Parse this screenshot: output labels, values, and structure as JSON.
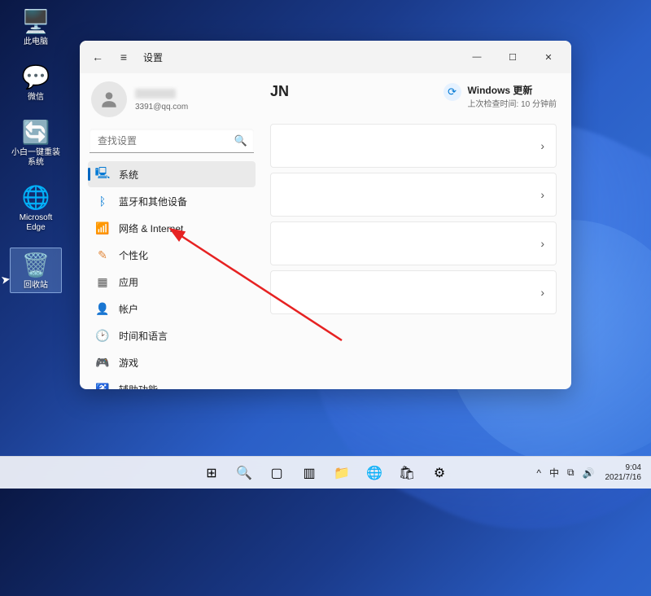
{
  "desktop": {
    "icons": [
      {
        "label": "此电脑",
        "glyph": "🖥️"
      },
      {
        "label": "微信",
        "glyph": "💬"
      },
      {
        "label": "小白一键重装系统",
        "glyph": "🔄"
      },
      {
        "label": "Microsoft Edge",
        "glyph": "🌐"
      },
      {
        "label": "回收站",
        "glyph": "🗑️"
      }
    ]
  },
  "window": {
    "title": "设置",
    "account": {
      "name": "",
      "email": "3391@qq.com"
    },
    "search_placeholder": "查找设置",
    "nav": [
      {
        "label": "系统",
        "icon": "display-icon",
        "glyph": "🖳",
        "color": "c-blue",
        "active": true
      },
      {
        "label": "蓝牙和其他设备",
        "icon": "bluetooth-icon",
        "glyph": "ᛒ",
        "color": "c-blue"
      },
      {
        "label": "网络 & Internet",
        "icon": "wifi-icon",
        "glyph": "📶",
        "color": "c-blue"
      },
      {
        "label": "个性化",
        "icon": "personalize-icon",
        "glyph": "✎",
        "color": "c-orange"
      },
      {
        "label": "应用",
        "icon": "apps-icon",
        "glyph": "▦",
        "color": "c-grey"
      },
      {
        "label": "帐户",
        "icon": "accounts-icon",
        "glyph": "👤",
        "color": "c-grey"
      },
      {
        "label": "时间和语言",
        "icon": "time-language-icon",
        "glyph": "🕑",
        "color": "c-grey"
      },
      {
        "label": "游戏",
        "icon": "gaming-icon",
        "glyph": "🎮",
        "color": "c-grey"
      },
      {
        "label": "辅助功能",
        "icon": "accessibility-icon",
        "glyph": "♿",
        "color": "c-blue"
      }
    ],
    "content": {
      "device_suffix": "JN",
      "update_title": "Windows 更新",
      "update_sub": "上次检查时间: 10 分钟前",
      "rows": 4
    }
  },
  "taskbar": {
    "items": [
      {
        "name": "start-button",
        "glyph": "⊞"
      },
      {
        "name": "search-button",
        "glyph": "🔍"
      },
      {
        "name": "taskview-button",
        "glyph": "▢"
      },
      {
        "name": "widgets-button",
        "glyph": "▥"
      },
      {
        "name": "explorer-button",
        "glyph": "📁"
      },
      {
        "name": "edge-button",
        "glyph": "🌐"
      },
      {
        "name": "store-button",
        "glyph": "🛍"
      },
      {
        "name": "settings-button",
        "glyph": "⚙"
      }
    ],
    "tray": {
      "chevron": "^",
      "ime": "中",
      "network": "⧉",
      "volume": "🔊"
    },
    "clock": {
      "time": "9:04",
      "date": "2021/7/16"
    }
  }
}
